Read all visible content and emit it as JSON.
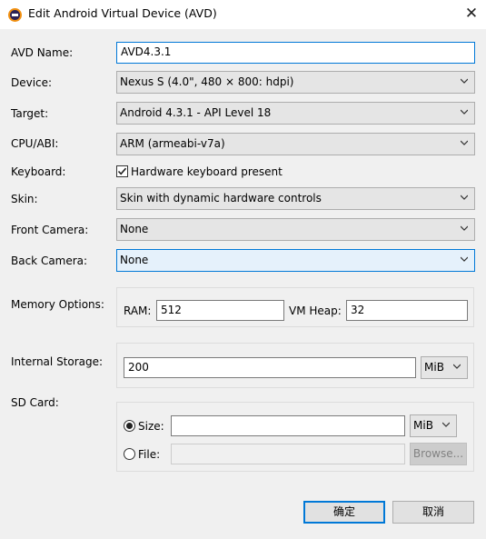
{
  "window": {
    "title": "Edit Android Virtual Device (AVD)",
    "app_icon": "eclipse-icon",
    "close_icon": "close-icon"
  },
  "form": {
    "avd_name": {
      "label": "AVD Name:",
      "value": "AVD4.3.1"
    },
    "device": {
      "label": "Device:",
      "value": "Nexus S (4.0\", 480 × 800: hdpi)"
    },
    "target": {
      "label": "Target:",
      "value": "Android 4.3.1 - API Level 18"
    },
    "cpu_abi": {
      "label": "CPU/ABI:",
      "value": "ARM (armeabi-v7a)"
    },
    "keyboard": {
      "label": "Keyboard:",
      "checkbox_label": "Hardware keyboard present",
      "checked": true
    },
    "skin": {
      "label": "Skin:",
      "value": "Skin with dynamic hardware controls"
    },
    "front_camera": {
      "label": "Front Camera:",
      "value": "None"
    },
    "back_camera": {
      "label": "Back Camera:",
      "value": "None"
    },
    "memory": {
      "label": "Memory Options:",
      "ram_label": "RAM:",
      "ram_value": "512",
      "vm_heap_label": "VM Heap:",
      "vm_heap_value": "32"
    },
    "internal_storage": {
      "label": "Internal Storage:",
      "value": "200",
      "unit": "MiB"
    },
    "sd_card": {
      "label": "SD Card:",
      "size_label": "Size:",
      "size_value": "",
      "size_unit": "MiB",
      "size_selected": true,
      "file_label": "File:",
      "file_value": "",
      "browse_label": "Browse..."
    }
  },
  "buttons": {
    "ok": "确定",
    "cancel": "取消"
  },
  "colors": {
    "accent": "#0078d7",
    "background": "#f0f0f0"
  }
}
